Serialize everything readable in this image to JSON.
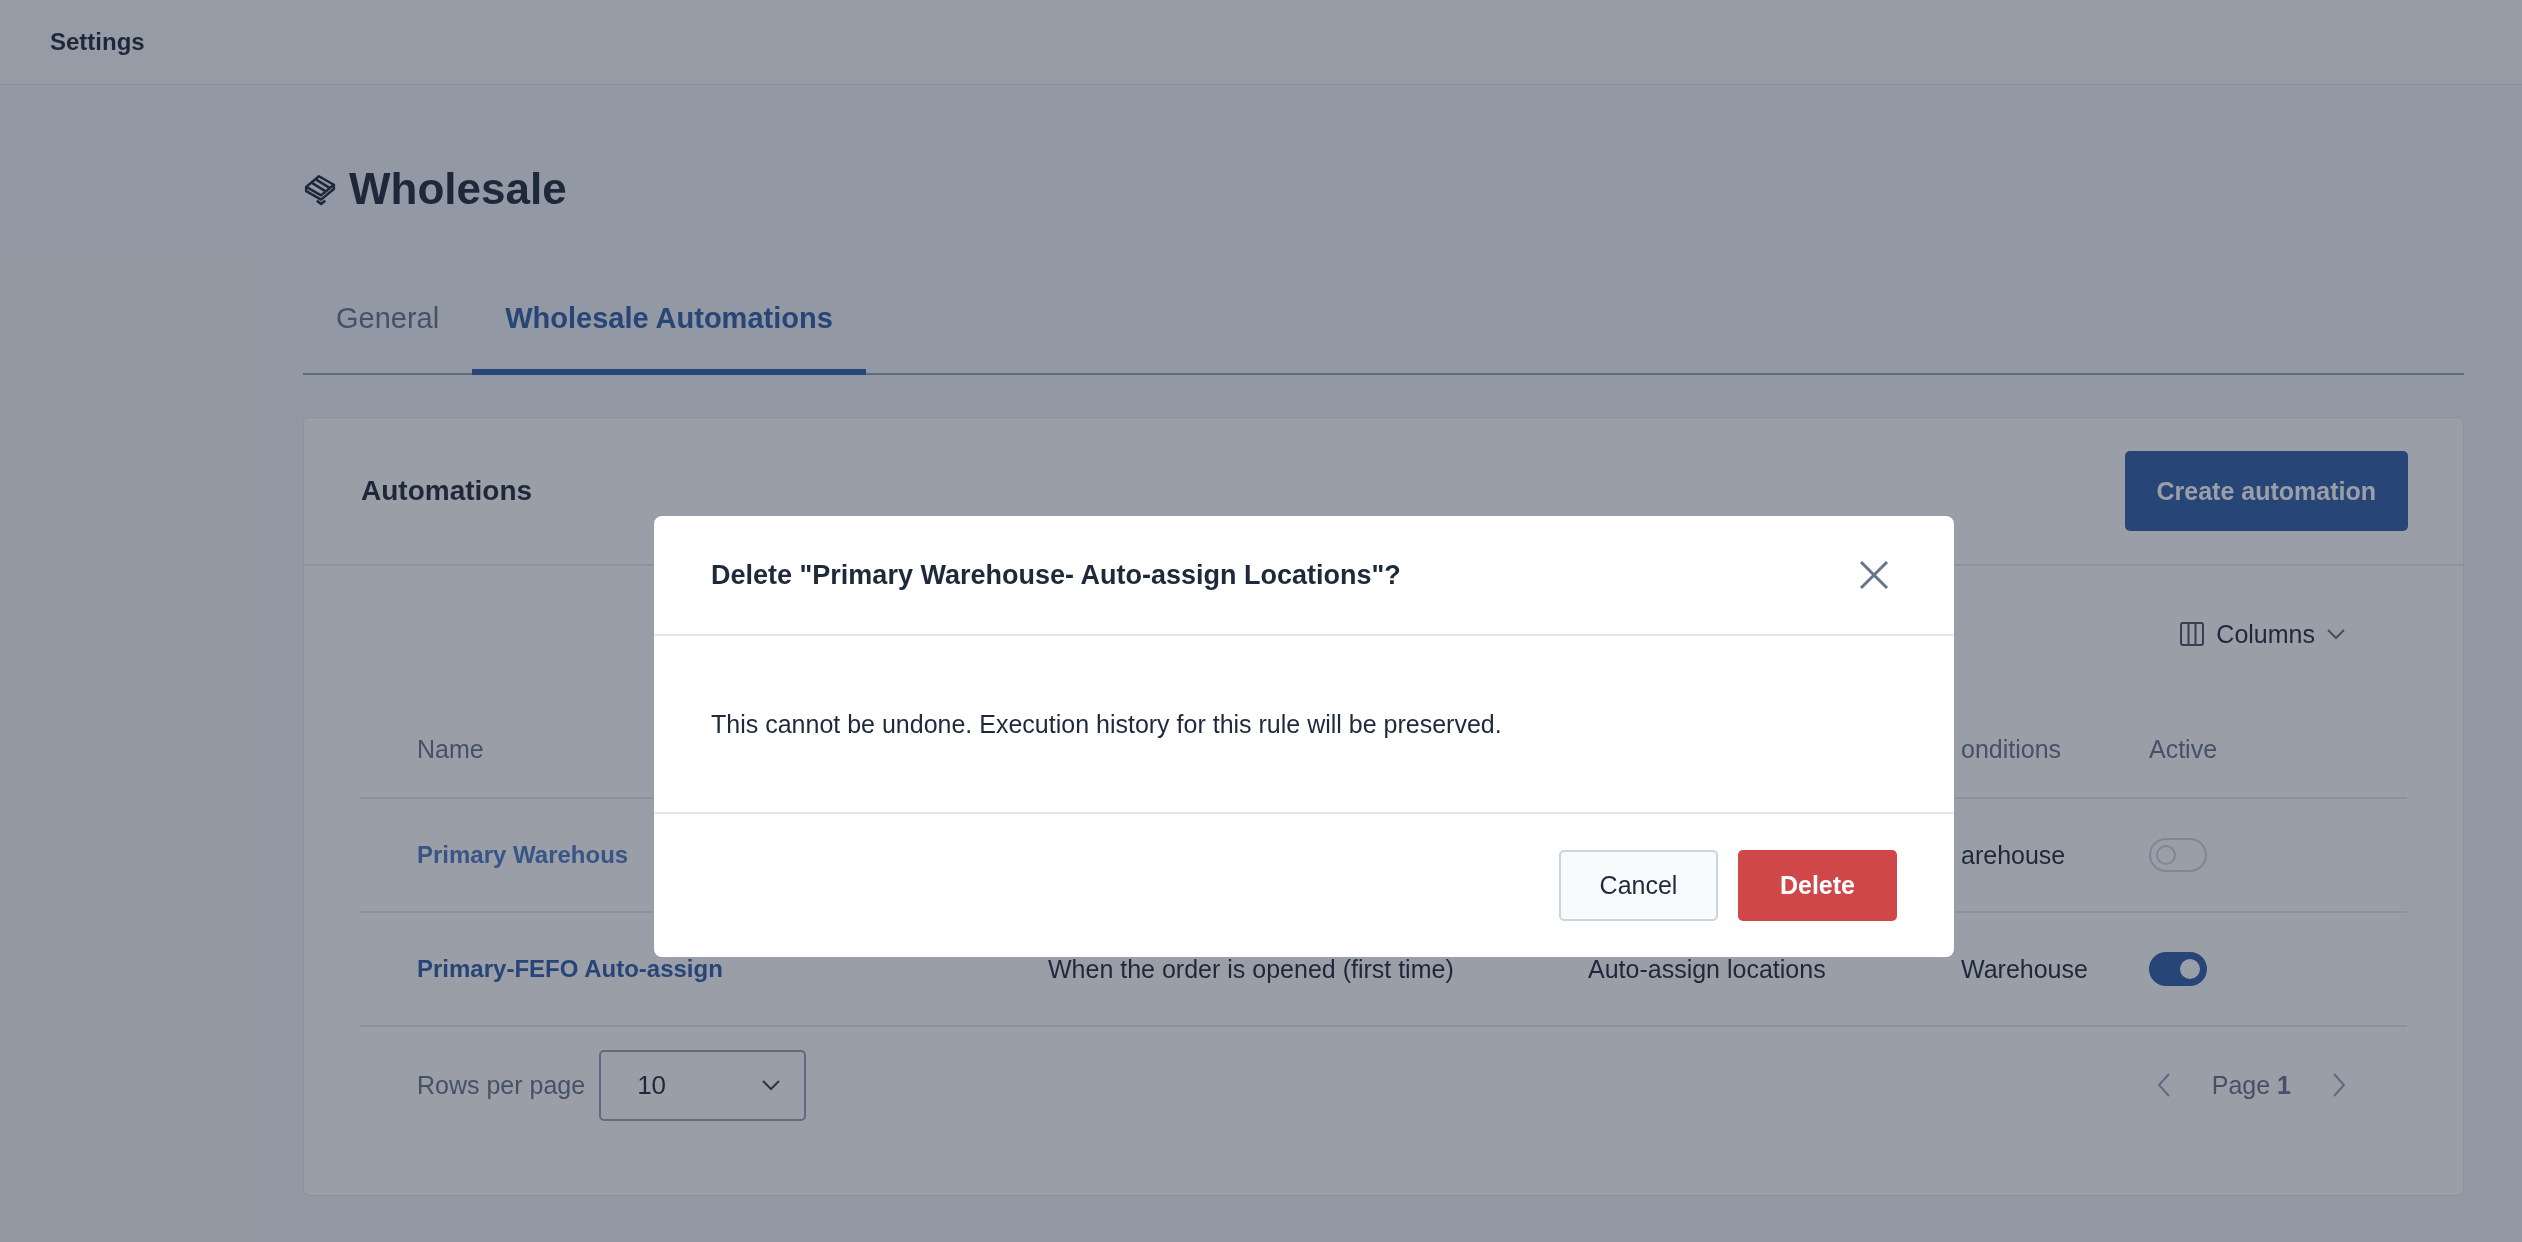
{
  "header": {
    "title": "Settings"
  },
  "page": {
    "title": "Wholesale"
  },
  "tabs": [
    {
      "label": "General",
      "selected": false
    },
    {
      "label": "Wholesale Automations",
      "selected": true
    }
  ],
  "card": {
    "title": "Automations",
    "create_button": "Create automation",
    "columns_button": "Columns"
  },
  "table": {
    "columns": {
      "name": "Name",
      "conditions": "onditions",
      "active": "Active"
    },
    "rows": [
      {
        "name": "Primary Warehous",
        "conditions": "arehouse",
        "active": false
      },
      {
        "name": "Primary-FEFO Auto-assign",
        "column_2": "When the order is opened (first time)",
        "column_3": "Auto-assign locations",
        "conditions": "Warehouse",
        "active": true
      }
    ]
  },
  "pagination": {
    "rows_label": "Rows per page",
    "rows_value": "10",
    "page": "Page **1**"
  },
  "modal": {
    "title": "Delete \"Primary Warehouse- Auto-assign Locations\"?",
    "message": "This cannot be undone. Execution history for this rule will be preserved.",
    "buttons": [
      {
        "label": "Cancel",
        "kind": "secondary"
      },
      {
        "label": "Delete",
        "kind": "danger"
      }
    ]
  }
}
